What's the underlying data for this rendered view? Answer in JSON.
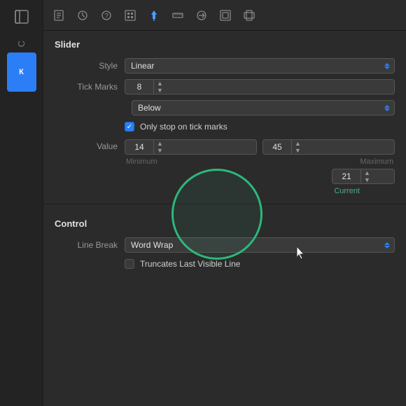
{
  "toolbar": {
    "icons": [
      {
        "name": "panel-icon",
        "symbol": "⊞",
        "active": false
      },
      {
        "name": "doc-icon",
        "symbol": "☐",
        "active": false
      },
      {
        "name": "clock-icon",
        "symbol": "◔",
        "active": false
      },
      {
        "name": "help-icon",
        "symbol": "?",
        "active": false
      },
      {
        "name": "grid-icon",
        "symbol": "⊟",
        "active": false
      },
      {
        "name": "pin-icon",
        "symbol": "⬆",
        "active": true
      },
      {
        "name": "ruler-icon",
        "symbol": "☰",
        "active": false
      },
      {
        "name": "arrow-icon",
        "symbol": "➡",
        "active": false
      },
      {
        "name": "stack-icon",
        "symbol": "⧉",
        "active": false
      },
      {
        "name": "rect-icon",
        "symbol": "▬",
        "active": false
      }
    ]
  },
  "sidebar": {
    "text": "С",
    "blue_label": "К"
  },
  "slider_section": {
    "title": "Slider",
    "style_label": "Style",
    "style_value": "Linear",
    "tick_marks_label": "Tick Marks",
    "tick_marks_value": "8",
    "tick_position_value": "Below",
    "checkbox_label": "Only stop on tick marks",
    "value_label": "Value",
    "minimum_value": "14",
    "maximum_value": "45",
    "current_value": "21",
    "min_label": "Minimum",
    "max_label": "Maximum",
    "current_label": "Current"
  },
  "control_section": {
    "title": "Control",
    "line_break_label": "Line Break",
    "line_break_value": "Word Wrap",
    "truncates_label": "Truncates Last Visible Line"
  }
}
